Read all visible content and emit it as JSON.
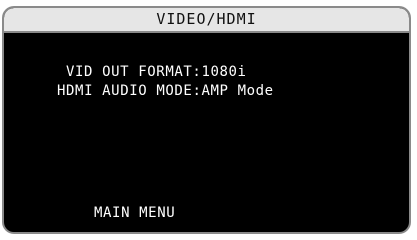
{
  "osd": {
    "title": "VIDEO/HDMI",
    "settings": [
      {
        "label": "VID OUT FORMAT",
        "value": "1080i"
      },
      {
        "label": "HDMI AUDIO MODE",
        "value": "AMP Mode"
      }
    ],
    "main_menu_label": "MAIN MENU"
  },
  "colors": {
    "background": "#000000",
    "title_bar": "#e6e6e6",
    "text": "#ffffff",
    "title_text": "#111111",
    "border": "#8a8a8a"
  }
}
